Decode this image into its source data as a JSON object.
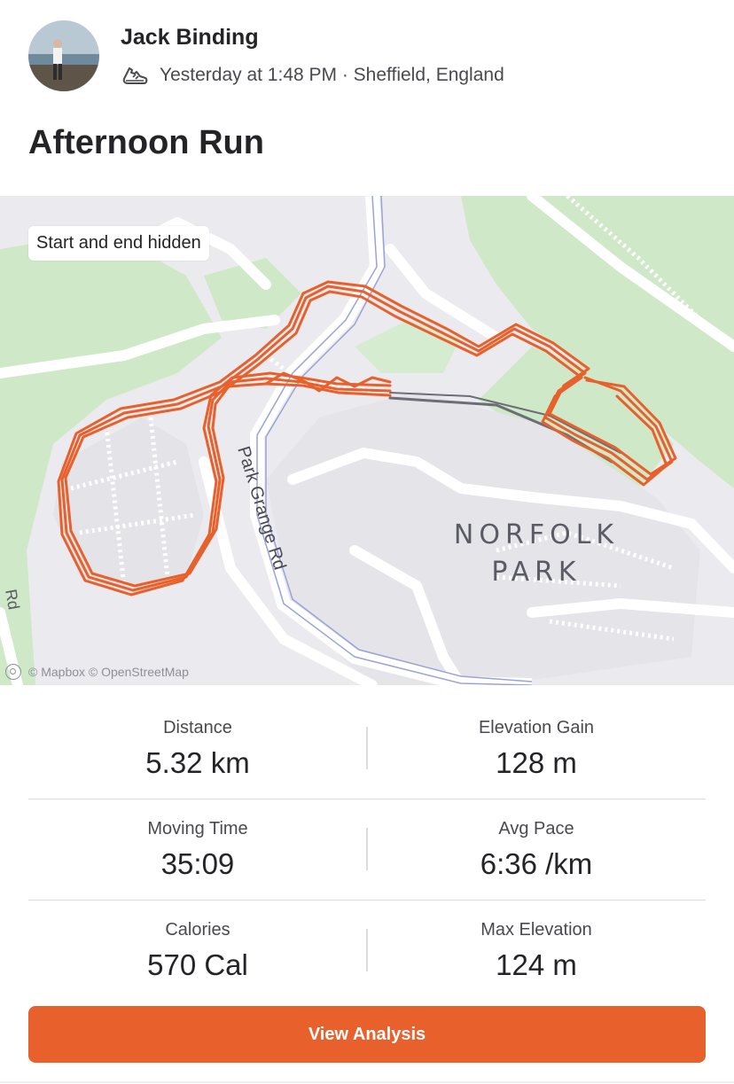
{
  "athlete": {
    "name": "Jack Binding"
  },
  "activity": {
    "meta": "Yesterday at 1:48 PM · Sheffield, England",
    "title": "Afternoon Run",
    "sport_icon": "running-shoe-icon"
  },
  "map": {
    "privacy_label": "Start and end hidden",
    "attribution": "© Mapbox © OpenStreetMap",
    "labels": {
      "road": "Park Grange Rd",
      "park_line1": "NORFOLK",
      "park_line2": "PARK",
      "edge_road": "Rd"
    },
    "route_color": "#e8602c",
    "hidden_segment_color": "#6d6d78"
  },
  "stats": {
    "distance": {
      "label": "Distance",
      "value": "5.32 km"
    },
    "elevation_gain": {
      "label": "Elevation Gain",
      "value": "128 m"
    },
    "moving_time": {
      "label": "Moving Time",
      "value": "35:09"
    },
    "avg_pace": {
      "label": "Avg Pace",
      "value": "6:36 /km"
    },
    "calories": {
      "label": "Calories",
      "value": "570 Cal"
    },
    "max_elevation": {
      "label": "Max Elevation",
      "value": "124 m"
    }
  },
  "actions": {
    "view_analysis": "View Analysis"
  },
  "colors": {
    "accent": "#e8602c",
    "text": "#242428",
    "muted": "#494950"
  }
}
